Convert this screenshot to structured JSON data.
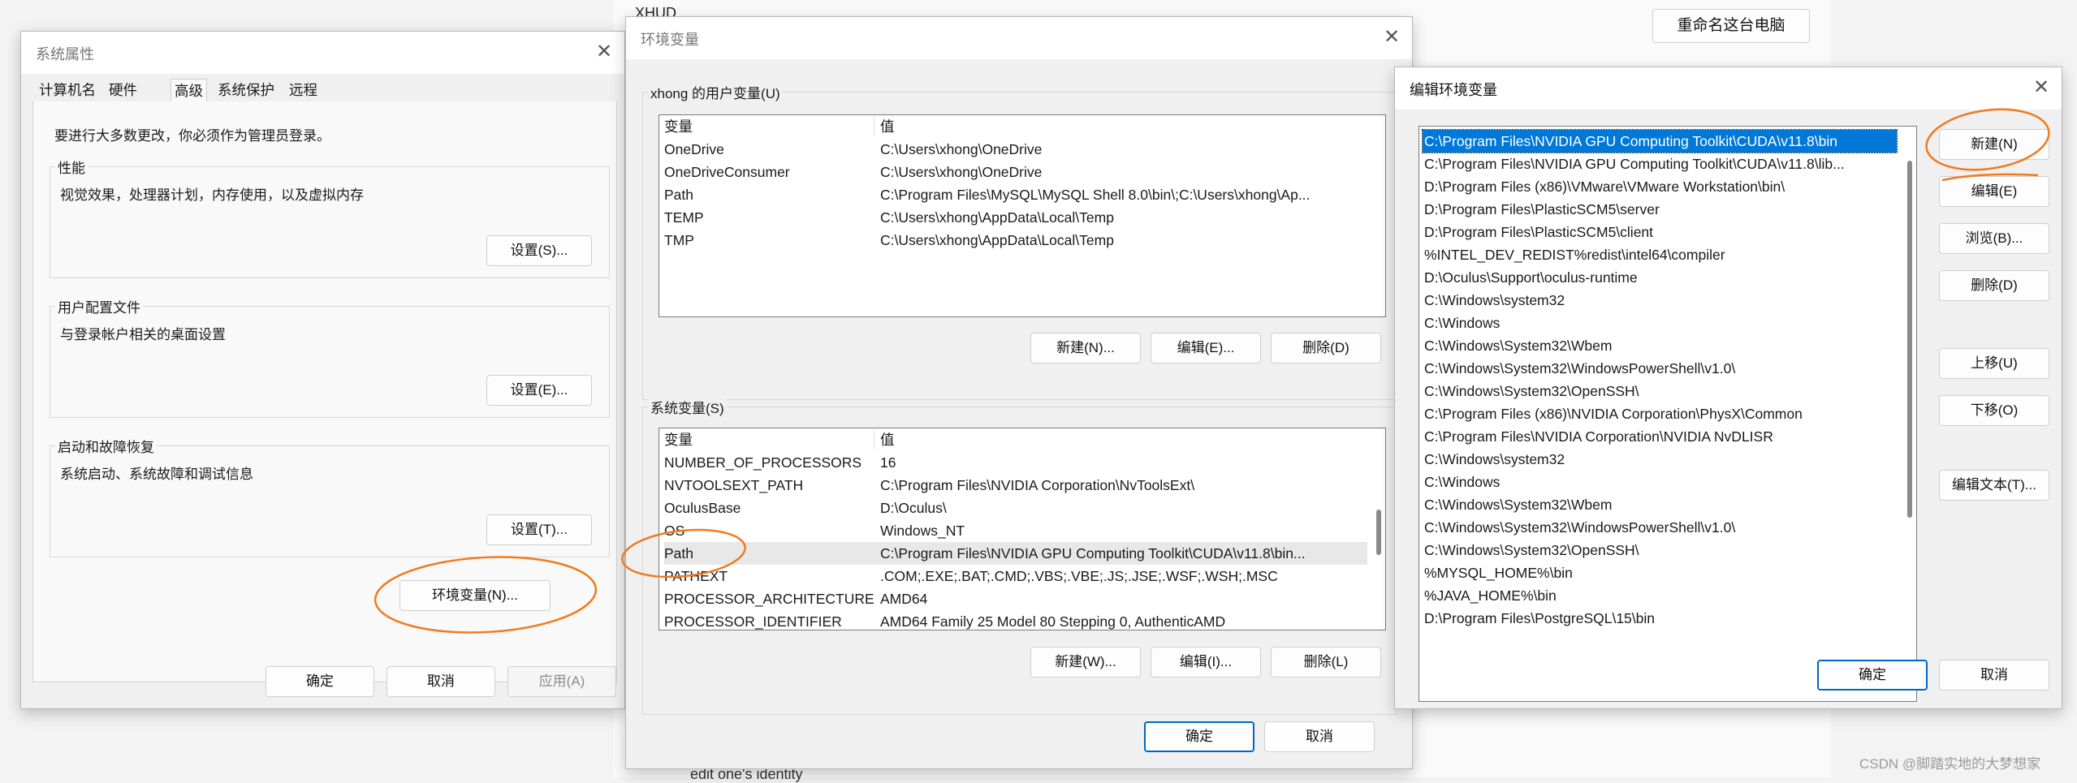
{
  "background": {
    "top_text": "XHUD",
    "rename_button": "重命名这台电脑",
    "bottom_text": "edit one's identity",
    "watermark": "CSDN @脚踏实地的大梦想家"
  },
  "sysprops": {
    "title": "系统属性",
    "tabs": [
      "计算机名",
      "硬件",
      "高级",
      "系统保护",
      "远程"
    ],
    "notice": "要进行大多数更改，你必须作为管理员登录。",
    "perf_label": "性能",
    "perf_desc": "视觉效果，处理器计划，内存使用，以及虚拟内存",
    "perf_button": "设置(S)...",
    "profile_label": "用户配置文件",
    "profile_desc": "与登录帐户相关的桌面设置",
    "profile_button": "设置(E)...",
    "startup_label": "启动和故障恢复",
    "startup_desc": "系统启动、系统故障和调试信息",
    "startup_button": "设置(T)...",
    "env_button": "环境变量(N)...",
    "ok": "确定",
    "cancel": "取消",
    "apply": "应用(A)"
  },
  "envvars": {
    "title": "环境变量",
    "user_group": "xhong 的用户变量(U)",
    "col_var": "变量",
    "col_val": "值",
    "user_vars": [
      {
        "name": "OneDrive",
        "value": "C:\\Users\\xhong\\OneDrive"
      },
      {
        "name": "OneDriveConsumer",
        "value": "C:\\Users\\xhong\\OneDrive"
      },
      {
        "name": "Path",
        "value": "C:\\Program Files\\MySQL\\MySQL Shell 8.0\\bin\\;C:\\Users\\xhong\\Ap..."
      },
      {
        "name": "TEMP",
        "value": "C:\\Users\\xhong\\AppData\\Local\\Temp"
      },
      {
        "name": "TMP",
        "value": "C:\\Users\\xhong\\AppData\\Local\\Temp"
      }
    ],
    "user_new": "新建(N)...",
    "user_edit": "编辑(E)...",
    "user_delete": "删除(D)",
    "sys_group": "系统变量(S)",
    "sys_vars": [
      {
        "name": "NUMBER_OF_PROCESSORS",
        "value": "16"
      },
      {
        "name": "NVTOOLSEXT_PATH",
        "value": "C:\\Program Files\\NVIDIA Corporation\\NvToolsExt\\"
      },
      {
        "name": "OculusBase",
        "value": "D:\\Oculus\\"
      },
      {
        "name": "OS",
        "value": "Windows_NT"
      },
      {
        "name": "Path",
        "value": "C:\\Program Files\\NVIDIA GPU Computing Toolkit\\CUDA\\v11.8\\bin..."
      },
      {
        "name": "PATHEXT",
        "value": ".COM;.EXE;.BAT;.CMD;.VBS;.VBE;.JS;.JSE;.WSF;.WSH;.MSC"
      },
      {
        "name": "PROCESSOR_ARCHITECTURE",
        "value": "AMD64"
      },
      {
        "name": "PROCESSOR_IDENTIFIER",
        "value": "AMD64 Family 25 Model 80 Stepping 0, AuthenticAMD"
      }
    ],
    "sys_new": "新建(W)...",
    "sys_edit": "编辑(I)...",
    "sys_delete": "删除(L)",
    "ok": "确定",
    "cancel": "取消"
  },
  "editenv": {
    "title": "编辑环境变量",
    "entries": [
      "C:\\Program Files\\NVIDIA GPU Computing Toolkit\\CUDA\\v11.8\\bin",
      "C:\\Program Files\\NVIDIA GPU Computing Toolkit\\CUDA\\v11.8\\lib...",
      "D:\\Program Files (x86)\\VMware\\VMware Workstation\\bin\\",
      "D:\\Program Files\\PlasticSCM5\\server",
      "D:\\Program Files\\PlasticSCM5\\client",
      "%INTEL_DEV_REDIST%redist\\intel64\\compiler",
      "D:\\Oculus\\Support\\oculus-runtime",
      "C:\\Windows\\system32",
      "C:\\Windows",
      "C:\\Windows\\System32\\Wbem",
      "C:\\Windows\\System32\\WindowsPowerShell\\v1.0\\",
      "C:\\Windows\\System32\\OpenSSH\\",
      "C:\\Program Files (x86)\\NVIDIA Corporation\\PhysX\\Common",
      "C:\\Program Files\\NVIDIA Corporation\\NVIDIA NvDLISR",
      "C:\\Windows\\system32",
      "C:\\Windows",
      "C:\\Windows\\System32\\Wbem",
      "C:\\Windows\\System32\\WindowsPowerShell\\v1.0\\",
      "C:\\Windows\\System32\\OpenSSH\\",
      "%MYSQL_HOME%\\bin",
      "%JAVA_HOME%\\bin",
      "D:\\Program Files\\PostgreSQL\\15\\bin"
    ],
    "new": "新建(N)",
    "edit": "编辑(E)",
    "browse": "浏览(B)...",
    "delete": "删除(D)",
    "move_up": "上移(U)",
    "move_down": "下移(O)",
    "edit_text": "编辑文本(T)...",
    "ok": "确定",
    "cancel": "取消"
  },
  "colors": {
    "selection": "#0078d7",
    "annotation": "#f07a1e",
    "primary_border": "#0067c0"
  }
}
